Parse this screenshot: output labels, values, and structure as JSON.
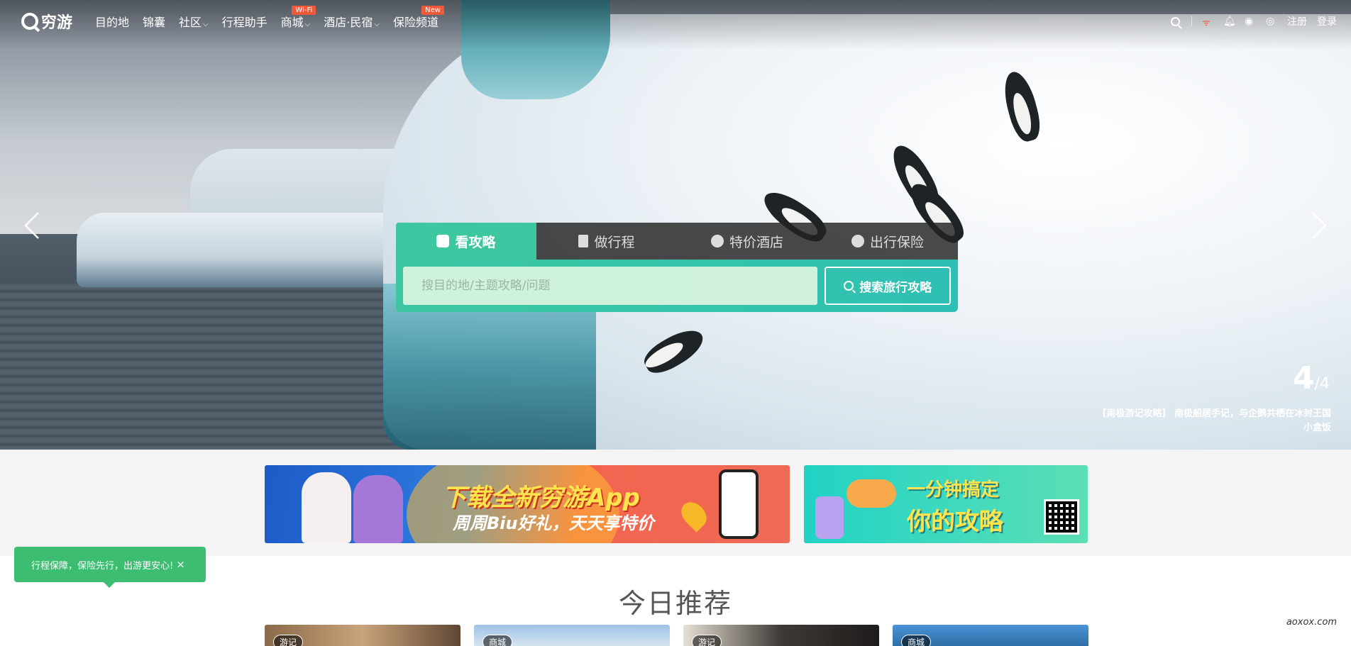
{
  "nav": {
    "logo": "穷游",
    "items": [
      {
        "label": "目的地",
        "dropdown": false,
        "badge": ""
      },
      {
        "label": "锦囊",
        "dropdown": false,
        "badge": ""
      },
      {
        "label": "社区",
        "dropdown": true,
        "badge": ""
      },
      {
        "label": "行程助手",
        "dropdown": false,
        "badge": ""
      },
      {
        "label": "商城",
        "dropdown": true,
        "badge": "Wi-Fi"
      },
      {
        "label": "酒店·民宿",
        "dropdown": true,
        "badge": ""
      },
      {
        "label": "保险频道",
        "dropdown": false,
        "badge": "New"
      }
    ],
    "register": "注册",
    "login": "登录"
  },
  "search": {
    "tabs": [
      "看攻略",
      "做行程",
      "特价酒店",
      "出行保险"
    ],
    "active_tab": 0,
    "placeholder": "搜目的地/主题攻略/问题",
    "button": "搜索旅行攻略"
  },
  "slider": {
    "current": "4",
    "total": "/4",
    "caption_line1": "【南极游记攻略】 南极船居手记，与企鹅共栖在冰封王国",
    "caption_line2": "小盒饭"
  },
  "banners": {
    "app_title": "下载全新穷游App",
    "app_subtitle": "周周Biu好礼，天天享特价",
    "ai_title1": "一分钟搞定",
    "ai_title2": "你的攻略"
  },
  "toast": {
    "text": "行程保障，保险先行，出游更安心!",
    "close": "×"
  },
  "recommend": {
    "title": "今日推荐",
    "cards": [
      {
        "tag": "游记"
      },
      {
        "tag": "商城"
      },
      {
        "tag": "游记"
      },
      {
        "tag": "商城"
      }
    ]
  },
  "watermark": "aoxox.com",
  "colors": {
    "accent": "#3cc7a0",
    "badge": "#f05a3a",
    "toast": "#3dbd72"
  }
}
